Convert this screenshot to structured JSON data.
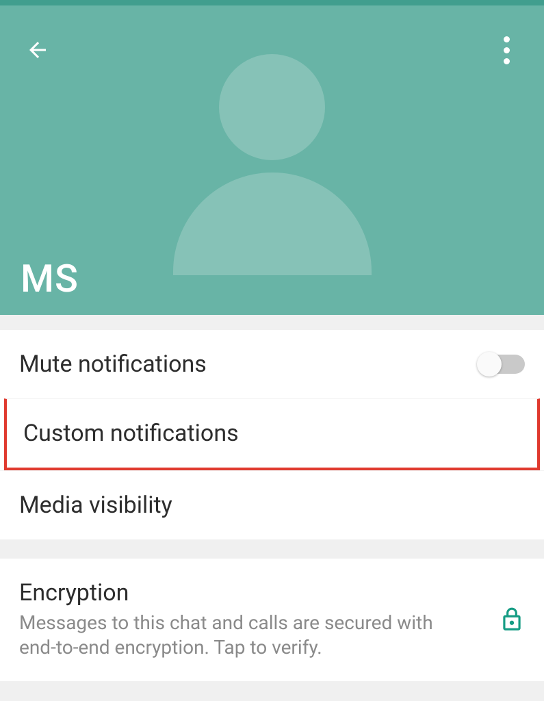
{
  "contact": {
    "name": "MS"
  },
  "settings": {
    "mute": {
      "label": "Mute notifications",
      "enabled": false
    },
    "custom": {
      "label": "Custom notifications"
    },
    "media": {
      "label": "Media visibility"
    },
    "encryption": {
      "label": "Encryption",
      "description": "Messages to this chat and calls are secured with end-to-end encryption. Tap to verify."
    }
  },
  "colors": {
    "accent_teal": "#68b4a6",
    "encryption_green": "#159c84",
    "highlight_red": "#e03a2f"
  }
}
